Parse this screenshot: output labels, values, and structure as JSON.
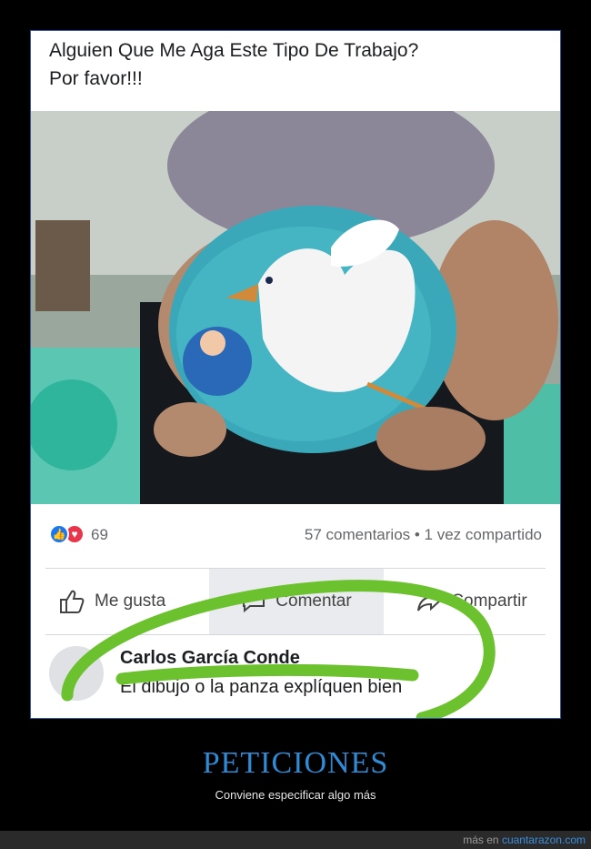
{
  "post": {
    "title_line1": "Alguien Que Me Aga Este Tipo De Trabajo?",
    "title_line2": "Por favor!!!",
    "reaction_count": "69",
    "comments_shares": "57 comentarios • 1 vez compartido",
    "actions": {
      "like": "Me gusta",
      "comment": "Comentar",
      "share": "Compartir"
    },
    "comment": {
      "author": "Carlos García Conde",
      "text": "El dibujo o la panza explíquen bien"
    }
  },
  "caption": {
    "title": "PETICIONES",
    "subtitle": "Conviene especificar algo más"
  },
  "footer": {
    "prefix": "más en",
    "link": "cuantarazon.com"
  },
  "colors": {
    "accent": "#2f8bd6",
    "facebook_blue": "#1877f2",
    "scribble_green": "#6cc22e",
    "belly_paint": "#3aa8b8"
  }
}
